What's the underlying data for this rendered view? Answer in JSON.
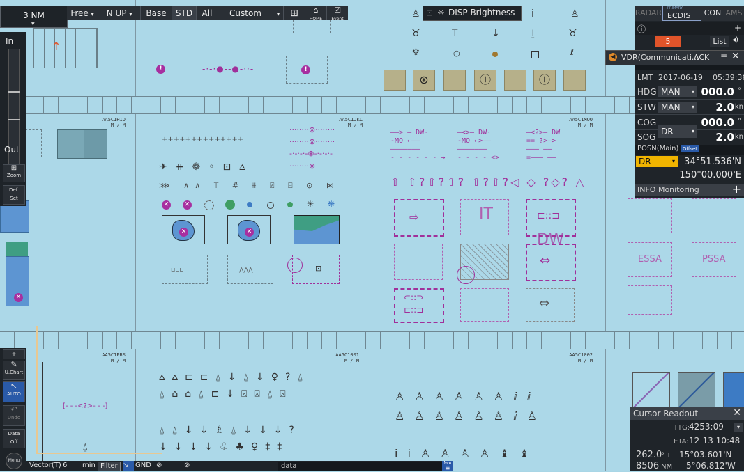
{
  "toolbar": {
    "range": "3 NM",
    "free": "Free",
    "nup": "N UP",
    "base": "Base",
    "std": "STD",
    "all": "All",
    "custom": "Custom",
    "home_label": "HOME",
    "event_label": "Event"
  },
  "disp_brightness": "DISP Brightness",
  "left_bar": {
    "in": "In",
    "out": "Out",
    "zoom": "Zoom",
    "def_set_1": "Def.",
    "def_set_2": "Set",
    "uchart": "U.Chart",
    "auto": "AUTO",
    "undo": "Undo",
    "data_1": "Data",
    "data_2": "Off",
    "menu": "Menu"
  },
  "bottom_bar": {
    "vector_label": "Vector(T)",
    "vector_value": "6",
    "vector_unit": "min",
    "filter": "Filter",
    "gnd": "GND",
    "data_field": "data",
    "new_badge": "New"
  },
  "tile_ids": {
    "t1": "AA5C1HID",
    "t2": "AA5C1JKL",
    "t3": "AA5C1MOO",
    "t4": "AA5C1PRS",
    "t5": "AA5C1001",
    "t6": "AA5C1002",
    "scale": "M / M"
  },
  "mode_tabs": {
    "radar": "RADAR",
    "primary": "PRIMARY",
    "ecdis": "ECDIS",
    "con": "CON",
    "ams": "AMS"
  },
  "alert": {
    "count": "5",
    "list": "List",
    "vdr_message": "VDR(Communicati...",
    "ack": "ACK"
  },
  "nav": {
    "lmt_label": "LMT",
    "date": "2017-06-19",
    "time": "05:39:36",
    "hdg_label": "HDG",
    "hdg_src": "MAN",
    "hdg_value": "000.0",
    "hdg_unit": "°",
    "stw_label": "STW",
    "stw_src": "MAN",
    "stw_value": "2.0",
    "stw_unit": "kn",
    "cog_label": "COG",
    "cog_value": "000.0",
    "cog_unit": "°",
    "sog_label": "SOG",
    "sog_src": "DR",
    "sog_value": "2.0",
    "sog_unit": "kn",
    "posn_label": "POSN(Main)",
    "offset": "Offset",
    "posn_src": "DR",
    "lat": "34°51.536'N",
    "lon": "150°00.000'E",
    "info": "INFO Monitoring"
  },
  "cursor": {
    "title": "Cursor Readout",
    "ttg_label": "TTG:",
    "ttg_value": "4253:09",
    "eta_label": "ETA:",
    "eta_value": "12-13 10:48",
    "brg_value": "262.0",
    "brg_unit": "° T",
    "lat_value": "15°03.601'N",
    "dist_value": "8506",
    "dist_unit": "NM",
    "lon_value": "5°06.812'W"
  },
  "chart_labels": {
    "dw": "DW",
    "it": "IT",
    "essa": "ESSA",
    "pssa": "PSSA"
  },
  "colors": {
    "sea": "#acd8e8",
    "magenta": "#a0309a",
    "panel": "#1f2429",
    "dr_yellow": "#f0b400",
    "alert_orange": "#e0542a"
  }
}
